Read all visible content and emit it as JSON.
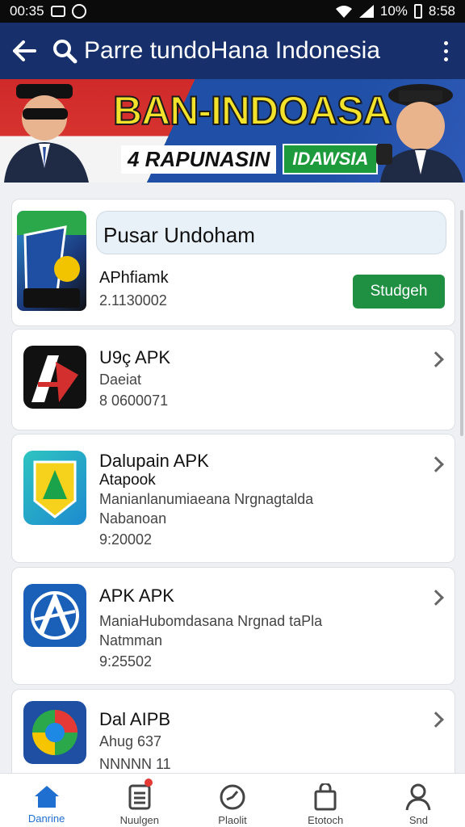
{
  "status_bar": {
    "left_time": "00:35",
    "battery": "10%",
    "clock": "8:58"
  },
  "app_bar": {
    "title": "Parre tundoHana Indonesia"
  },
  "banner": {
    "headline": "BAN-INDOASA",
    "tagline_a": "4 RAPUNASIN",
    "tagline_b": "IDAWSIA"
  },
  "featured": {
    "search_value": "Pusar Undoham",
    "name": "APhfiamk",
    "version": "2.1130002",
    "button_label": "Studgeh"
  },
  "apps": [
    {
      "name": "U9ç APK",
      "sub": "Daeiat",
      "meta": "8 0600071"
    },
    {
      "name": "Dalupain APK",
      "sub": "Atapook",
      "desc": "Manianlanumiaeana Nrgnagtalda",
      "desc2": "Nabanoan",
      "meta": "9:20002"
    },
    {
      "name": "APK APK",
      "desc": "ManiaHubomdasana Nrgnad taPla",
      "desc2": "Natmman",
      "meta": "9:25502"
    },
    {
      "name": "Dal AIPB",
      "sub": "Ahug 637",
      "meta": "NNNNN 11"
    }
  ],
  "bottom_nav": [
    {
      "label": "Danrine",
      "icon": "home-icon"
    },
    {
      "label": "Nuulgen",
      "icon": "list-icon"
    },
    {
      "label": "Plaolit",
      "icon": "clock-icon"
    },
    {
      "label": "Etotoch",
      "icon": "bag-icon"
    },
    {
      "label": "Snd",
      "icon": "person-icon"
    }
  ],
  "colors": {
    "appbar": "#17306b",
    "accent": "#1f6fd1",
    "button": "#1f8f42",
    "badge": "#e53935"
  }
}
